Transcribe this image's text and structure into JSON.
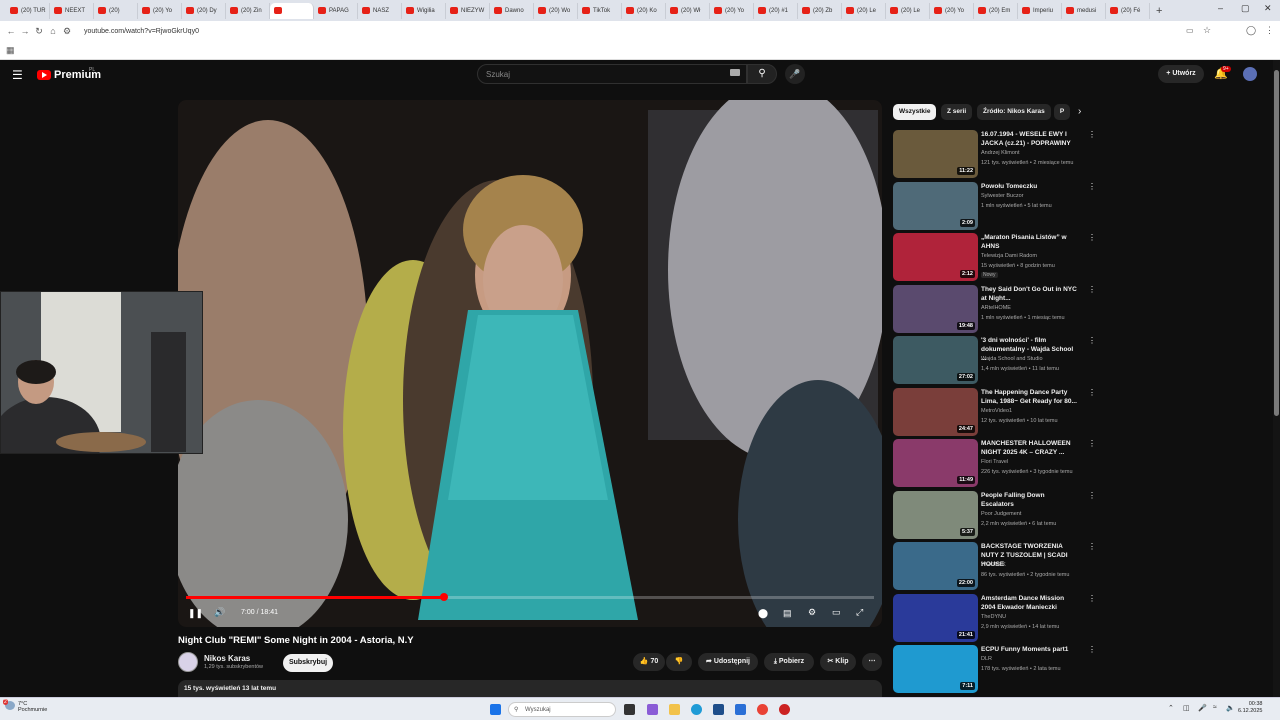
{
  "browser": {
    "tabs": [
      "(20) TUR",
      "NEEXT",
      "(20)",
      "(20) Yo",
      "(20) Dy",
      "(20) Zin",
      "",
      "PAPAG",
      "NASZ",
      "Wigilia",
      "NIEZYW",
      "Dawno",
      "(20) Wo",
      "TikTok",
      "(20) Ko",
      "(20) Wł",
      "(20) Yo",
      "(20) #1",
      "(20) Zb",
      "(20) Le",
      "(20) Le",
      "(20) Yo",
      "(20) Em",
      "Imperiu",
      "medusi",
      "(20) Fé"
    ],
    "url": "youtube.com/watch?v=RjwoGkrUqy0",
    "window_controls": [
      "–",
      "▢",
      "✕"
    ]
  },
  "header": {
    "logo_text": "Premium",
    "logo_region": "PL",
    "search_placeholder": "Szukaj",
    "create_label": "Utwórz",
    "notif_count": "9+"
  },
  "player": {
    "time": "7:00 / 18:41",
    "progress": 0.375
  },
  "video": {
    "title": "Night Club \"REMI\" Some Night in 2004 - Astoria, N.Y",
    "channel": "Nikos Karas",
    "subscribers": "1,29 tys. subskrybentów",
    "subscribe_label": "Subskrybuj",
    "likes": "70",
    "share_label": "Udostępnij",
    "download_label": "Pobierz",
    "clip_label": "Klip",
    "views_date": "15 tys. wyświetleń  13 lat temu"
  },
  "chips": [
    "Wszystkie",
    "Z serii",
    "Źródło: Nikos Karas",
    "P"
  ],
  "recommendations": [
    {
      "title": "16.07.1994 - WESELE EWY I JACKA (cz.21) - POPRAWINY",
      "channel": "Andrzej Klimont",
      "meta": "121 tys. wyświetleń • 2 miesiące temu",
      "duration": "11:22",
      "thumb": "#6a5a3c"
    },
    {
      "title": "Powołu Tomeczku",
      "channel": "Sylwester Buczor",
      "meta": "1 mln wyświetleń • 5 lat temu",
      "duration": "2:09",
      "thumb": "#4f6a78"
    },
    {
      "title": "„Maraton Pisania Listów” w AHNS",
      "channel": "Telewizja Dami Radom",
      "meta": "15 wyświetleń • 8 godzin temu",
      "duration": "2:12",
      "badge": "Nowy",
      "thumb": "#b0233a"
    },
    {
      "title": "They Said Don't Go Out in NYC at Night...",
      "channel": "ARtelHOME",
      "meta": "1 mln wyświetleń • 1 miesiąc temu",
      "duration": "19:48",
      "thumb": "#5a4a6e"
    },
    {
      "title": "'3 dni wolności' - film dokumentalny - Wajda School ...",
      "channel": "Wajda School and Studio",
      "meta": "1,4 mln wyświetleń • 11 lat temu",
      "duration": "27:02",
      "thumb": "#3d5a62"
    },
    {
      "title": "The Happening Dance Party Lima, 1988~ Get Ready for 80...",
      "channel": "MetroVideo1",
      "meta": "12 tys. wyświetleń • 10 lat temu",
      "duration": "24:47",
      "thumb": "#7a3e3a"
    },
    {
      "title": "MANCHESTER HALLOWEEN NIGHT 2025 4K – CRAZY ...",
      "channel": "Flori Travel",
      "meta": "226 tys. wyświetleń • 3 tygodnie temu",
      "duration": "11:49",
      "thumb": "#8a3a6a"
    },
    {
      "title": "People Falling Down Escalators",
      "channel": "Poor Judgement",
      "meta": "2,2 mln wyświetleń • 6 lat temu",
      "duration": "5:37",
      "thumb": "#7f8a7a"
    },
    {
      "title": "BACKSTAGE TWORZENIA NUTY Z TUSZOLEM | SCADI HOUSE",
      "channel": "WRONEK",
      "meta": "86 tys. wyświetleń • 2 tygodnie temu",
      "duration": "22:00",
      "thumb": "#3a6a8a"
    },
    {
      "title": "Amsterdam Dance Mission 2004 Ekwador Manieczki",
      "channel": "TheDYNU",
      "meta": "2,9 mln wyświetleń • 14 lat temu",
      "duration": "21:41",
      "thumb": "#2a3a9a"
    },
    {
      "title": "ECPU Funny Moments part1",
      "channel": "DLR",
      "meta": "178 tys. wyświetleń • 2 lata temu",
      "duration": "7:11",
      "thumb": "#1f9ad0"
    }
  ],
  "taskbar": {
    "weather_temp": "7°C",
    "weather_desc": "Pochmurnie",
    "weather_badge": "2",
    "search_placeholder": "Wyszukaj",
    "time": "00:38",
    "date": "6.12.2025"
  }
}
